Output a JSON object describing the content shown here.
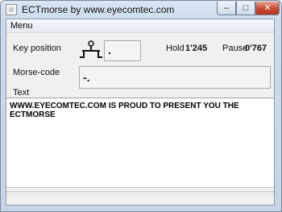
{
  "window": {
    "title": "ECTmorse by www.eyecomtec.com",
    "minimize_glyph": "–",
    "maximize_glyph": "□",
    "close_glyph": "✕"
  },
  "menu": {
    "items": [
      {
        "label": "Menu"
      }
    ]
  },
  "key_position": {
    "label": "Key position",
    "icon": "telegraph-key-icon",
    "value": "."
  },
  "timing": {
    "hold_label": "Hold",
    "hold_value": "1'245",
    "pause_label": "Pause",
    "pause_value": "0'767"
  },
  "morse_code": {
    "label": "Morse-code",
    "value": "-."
  },
  "text": {
    "label": "Text",
    "content": "WWW.EYECOMTEC.COM IS PROUD TO PRESENT YOU THE ECTMORSE"
  }
}
